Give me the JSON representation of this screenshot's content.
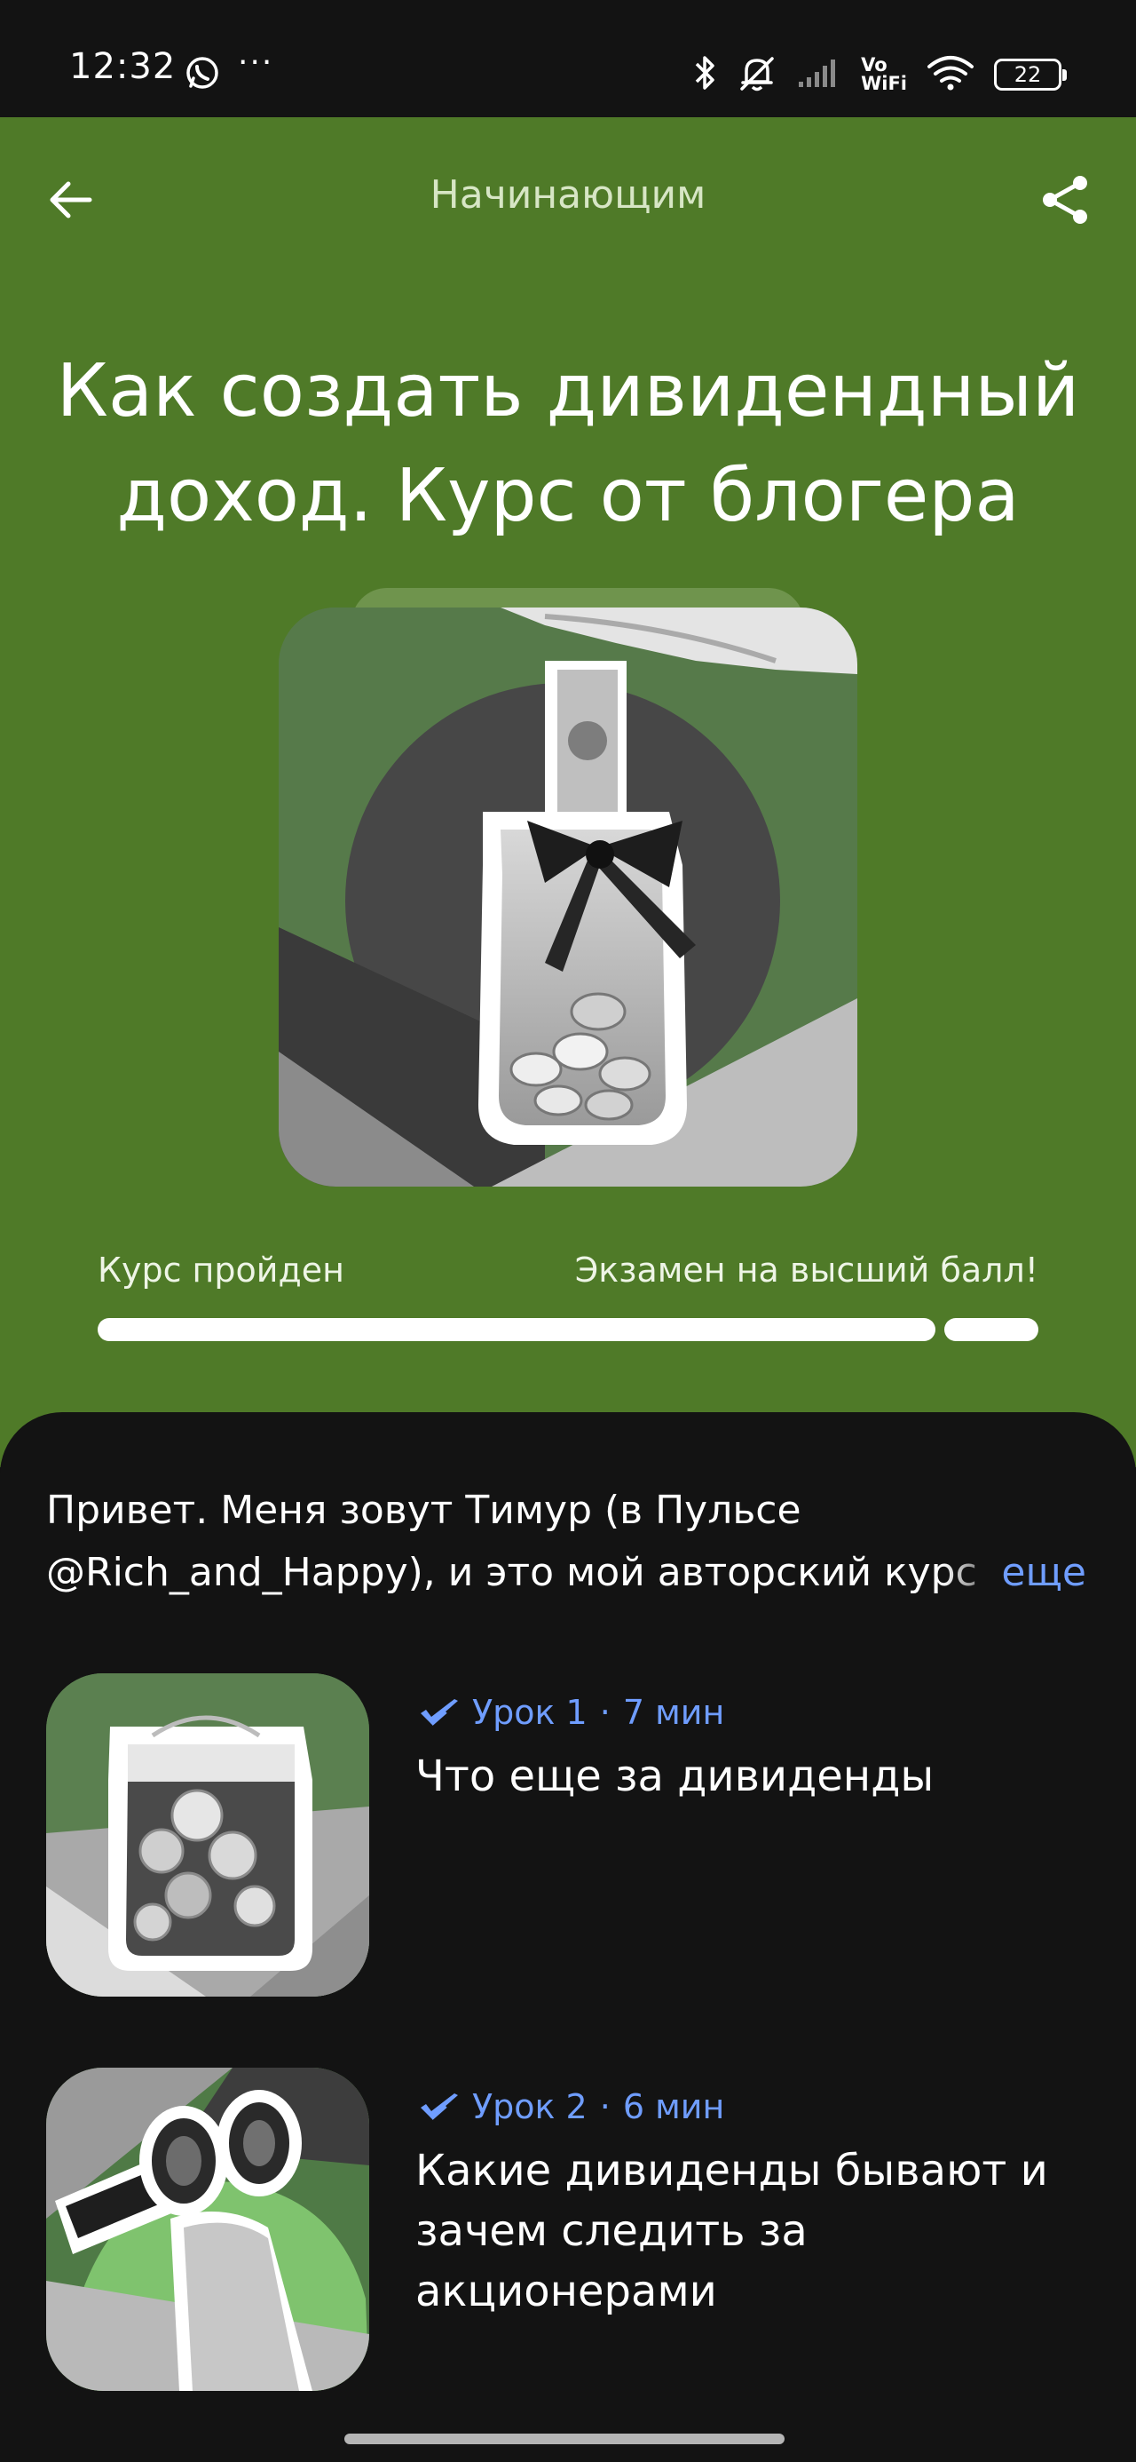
{
  "status_bar": {
    "time": "12:32",
    "more_dots": "···",
    "vowifi_top": "Vo",
    "vowifi_bottom": "WiFi",
    "battery": "22"
  },
  "header": {
    "nav_title": "Начинающим",
    "course_title": "Как создать дивидендный доход. Курс от блогера",
    "progress": {
      "left_label": "Курс пройден",
      "right_label": "Экзамен на высший балл!",
      "course_fraction": 0.895,
      "exam_fraction": 0.105
    }
  },
  "intro": {
    "text": "Привет. Меня зовут Тимур (в Пульсе @Rich_and_Happy), и это мой авторский курс",
    "more": "еще"
  },
  "lessons": [
    {
      "number": "Урок 1",
      "separator": "·",
      "duration": "7 мин",
      "title": "Что еще за дивиденды"
    },
    {
      "number": "Урок 2",
      "separator": "·",
      "duration": "6 мин",
      "title": "Какие дивиденды бывают и зачем следить за акционерами"
    }
  ],
  "colors": {
    "header_green": "#4f7a28",
    "accent_blue": "#6f9dff",
    "background": "#131313"
  },
  "icons": {
    "back": "arrow-left-icon",
    "share": "share-icon",
    "check": "checkmark-icon"
  }
}
